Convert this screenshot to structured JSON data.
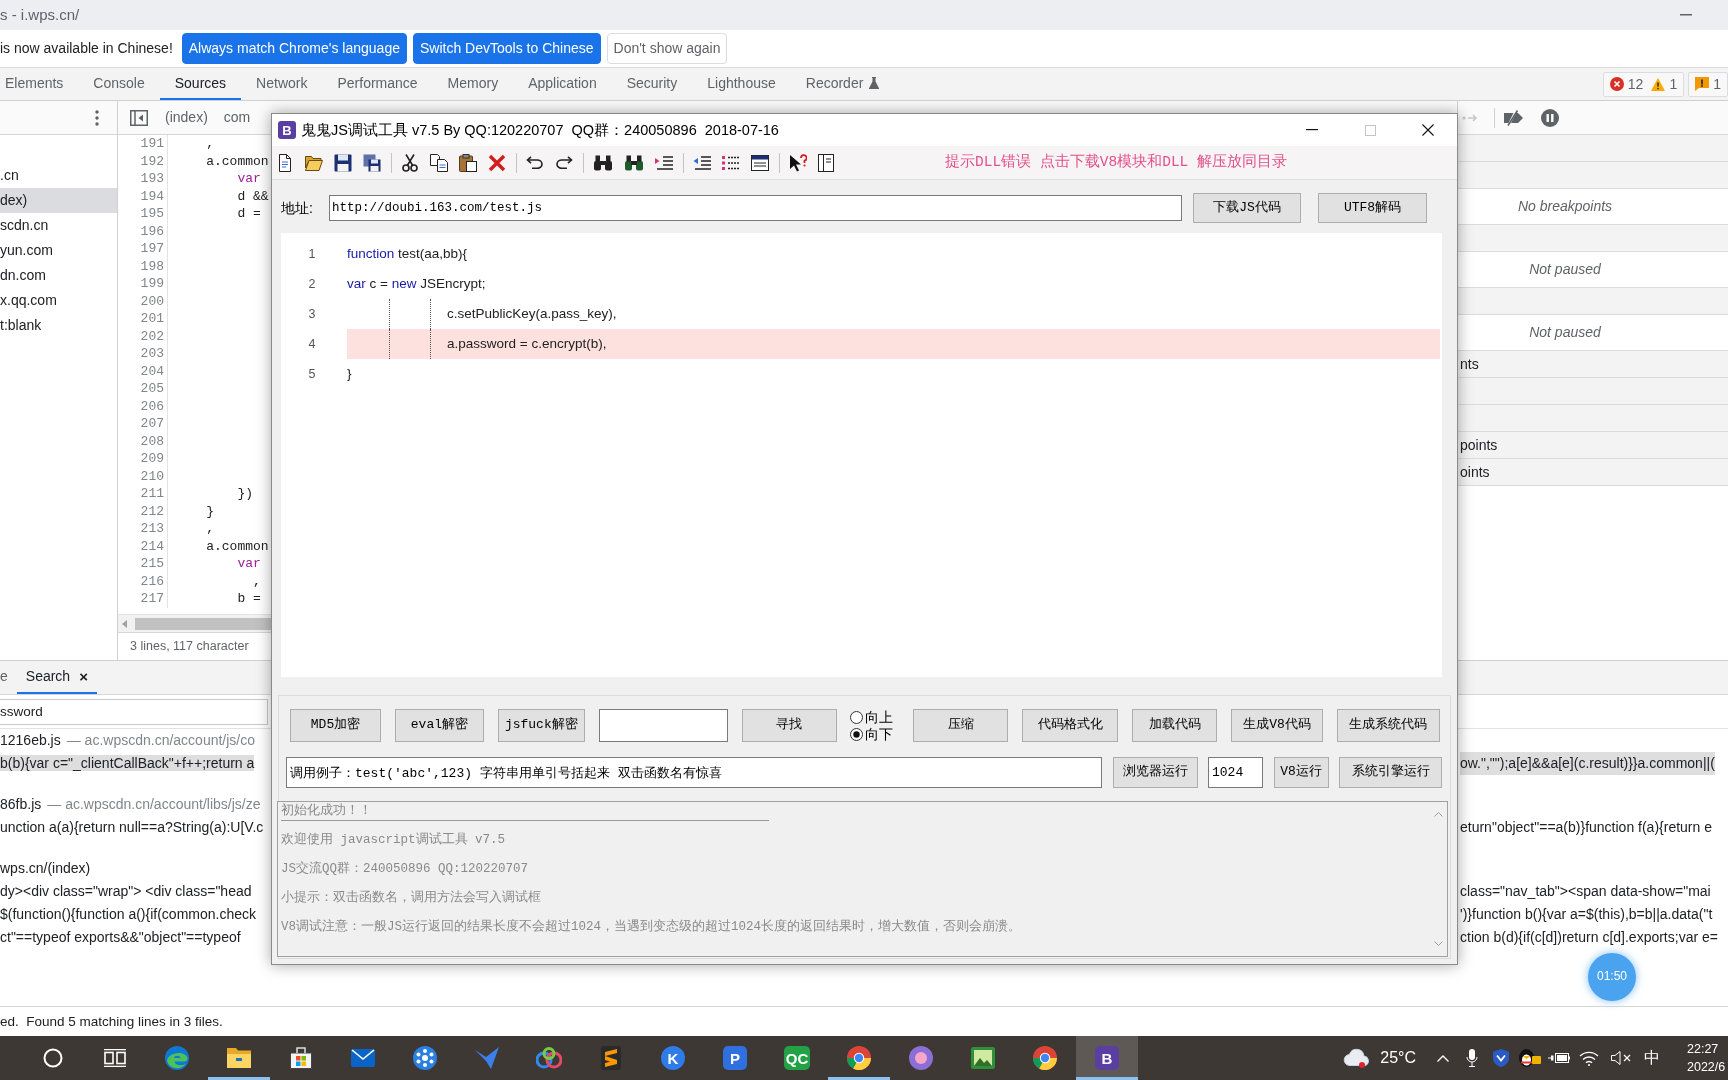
{
  "browser": {
    "title": "s - i.wps.cn/"
  },
  "infobar": {
    "message": "is now available in Chinese!",
    "buttons": [
      {
        "label": "Always match Chrome's language",
        "kind": "primary"
      },
      {
        "label": "Switch DevTools to Chinese",
        "kind": "primary"
      },
      {
        "label": "Don't show again",
        "kind": "secondary"
      }
    ]
  },
  "devtools_tabs": [
    {
      "label": "Elements",
      "selected": false,
      "experimental": false
    },
    {
      "label": "Console",
      "selected": false,
      "experimental": false
    },
    {
      "label": "Sources",
      "selected": true,
      "experimental": false
    },
    {
      "label": "Network",
      "selected": false,
      "experimental": false
    },
    {
      "label": "Performance",
      "selected": false,
      "experimental": false
    },
    {
      "label": "Memory",
      "selected": false,
      "experimental": false
    },
    {
      "label": "Application",
      "selected": false,
      "experimental": false
    },
    {
      "label": "Security",
      "selected": false,
      "experimental": false
    },
    {
      "label": "Lighthouse",
      "selected": false,
      "experimental": false
    },
    {
      "label": "Recorder",
      "selected": false,
      "experimental": true
    }
  ],
  "issue_counters": [
    {
      "items": [
        {
          "kind": "error",
          "count": "12"
        },
        {
          "kind": "warning",
          "count": "1"
        }
      ]
    },
    {
      "items": [
        {
          "kind": "issue",
          "count": "1"
        }
      ]
    }
  ],
  "navigator": {
    "items": [
      {
        "label": ".cn",
        "selected": false
      },
      {
        "label": "dex)",
        "selected": true
      },
      {
        "label": "scdn.cn",
        "selected": false
      },
      {
        "label": "yun.com",
        "selected": false
      },
      {
        "label": "dn.com",
        "selected": false
      },
      {
        "label": "x.qq.com",
        "selected": false
      },
      {
        "label": "t:blank",
        "selected": false
      }
    ]
  },
  "editor": {
    "tabs": [
      {
        "label": "(index)"
      },
      {
        "label": "com"
      }
    ],
    "lines": [
      {
        "number": "191",
        "code": "    ,"
      },
      {
        "number": "192",
        "code": "    a.common"
      },
      {
        "number": "193",
        "code": "        var",
        "kind": "keyword"
      },
      {
        "number": "194",
        "code": "        d &&"
      },
      {
        "number": "195",
        "code": "        d ="
      },
      {
        "number": "196"
      },
      {
        "number": "197"
      },
      {
        "number": "198"
      },
      {
        "number": "199"
      },
      {
        "number": "200"
      },
      {
        "number": "201"
      },
      {
        "number": "202"
      },
      {
        "number": "203"
      },
      {
        "number": "204"
      },
      {
        "number": "205"
      },
      {
        "number": "206"
      },
      {
        "number": "207"
      },
      {
        "number": "208"
      },
      {
        "number": "209"
      },
      {
        "number": "210"
      },
      {
        "number": "211",
        "code": "        })"
      },
      {
        "number": "212",
        "code": "    }"
      },
      {
        "number": "213",
        "code": "    ,"
      },
      {
        "number": "214",
        "code": "    a.common"
      },
      {
        "number": "215",
        "code": "        var",
        "kind": "keyword"
      },
      {
        "number": "216",
        "code": "          ,"
      },
      {
        "number": "217",
        "code": "        b ="
      }
    ],
    "status": "3 lines, 117 character"
  },
  "debugger_pane": {
    "rows": [
      {
        "kind": "header"
      },
      {
        "kind": "header"
      },
      {
        "kind": "message",
        "text": "No breakpoints"
      },
      {
        "kind": "header"
      },
      {
        "kind": "message",
        "text": "Not paused"
      },
      {
        "kind": "header"
      },
      {
        "kind": "message",
        "text": "Not paused"
      },
      {
        "kind": "header",
        "text": "nts"
      },
      {
        "kind": "header"
      },
      {
        "kind": "header"
      },
      {
        "kind": "header",
        "text": "points"
      },
      {
        "kind": "header",
        "text": "oints"
      }
    ]
  },
  "drawer": {
    "tabs": [
      {
        "label": "e",
        "selected": false
      },
      {
        "label": "Search",
        "selected": true,
        "close": "×"
      }
    ],
    "query": "ssword",
    "results": [
      {
        "kind": "file",
        "name": "1216eb.js",
        "path": "— ac.wpscdn.cn/account/js/co",
        "selected": false
      },
      {
        "kind": "match",
        "left": "b(b){var c=\"_clientCallBack\"+f++;return a",
        "right": "ow.\",\"\");a[e]&&a[e](c.result)}}a.common||(",
        "selected": true
      },
      {
        "kind": "file",
        "name": "86fb.js",
        "path": "— ac.wpscdn.cn/account/libs/js/ze",
        "selected": false
      },
      {
        "kind": "match",
        "left": "unction a(a){return null==a?String(a):U[V.c",
        "right": "eturn\"object\"==a(b)}function f(a){return e",
        "selected": false
      },
      {
        "kind": "file",
        "name": "wps.cn/(index)",
        "selected": false
      },
      {
        "kind": "match",
        "left": "dy><div class=\"wrap\"> <div class=\"head",
        "right": "class=\"nav_tab\"><span data-show=\"mai",
        "selected": false
      },
      {
        "kind": "match",
        "left": "$(function(){function a(){if(common.check",
        "right": "')}function b(){var a=$(this),b=b||a.data(\"t",
        "selected": false
      },
      {
        "kind": "match",
        "left": "ct\"==typeof exports&&\"object\"==typeof",
        "right": "ction b(d){if(c[d])return c[d].exports;var e=",
        "selected": false
      }
    ],
    "status": "ed.  Found 5 matching lines in 3 files."
  },
  "tool_window": {
    "logo": "B",
    "title": "鬼鬼JS调试工具 v7.5 By QQ:120220707  QQ群：240050896  2018-07-16",
    "toolbar": [
      {
        "kind": "new"
      },
      {
        "kind": "open"
      },
      {
        "kind": "save"
      },
      {
        "kind": "save-all"
      },
      {
        "kind": "separator"
      },
      {
        "kind": "cut"
      },
      {
        "kind": "copy"
      },
      {
        "kind": "paste"
      },
      {
        "kind": "delete"
      },
      {
        "kind": "separator"
      },
      {
        "kind": "undo"
      },
      {
        "kind": "redo"
      },
      {
        "kind": "separator"
      },
      {
        "kind": "find"
      },
      {
        "kind": "find-next"
      },
      {
        "kind": "indent"
      },
      {
        "kind": "separator"
      },
      {
        "kind": "outdent"
      },
      {
        "kind": "numbered-list"
      },
      {
        "kind": "window"
      },
      {
        "kind": "separator"
      },
      {
        "kind": "help-pointer"
      },
      {
        "kind": "panel"
      }
    ],
    "notice": "提示DLL错误 点击下载V8模块和DLL 解压放同目录",
    "address": {
      "label": "地址:",
      "value": "http://doubi.163.com/test.js",
      "buttons": [
        "下载JS代码",
        "UTF8解码"
      ]
    },
    "code": [
      {
        "number": "1",
        "indented": false,
        "highlighted": false,
        "tokens": [
          {
            "text": "function",
            "kind": "keyword"
          },
          {
            "text": " test(aa,bb){",
            "kind": "plain"
          }
        ]
      },
      {
        "number": "2",
        "indented": false,
        "highlighted": false,
        "tokens": [
          {
            "text": "var",
            "kind": "keyword"
          },
          {
            "text": " c = ",
            "kind": "plain"
          },
          {
            "text": "new",
            "kind": "keyword"
          },
          {
            "text": " JSEncrypt;",
            "kind": "plain"
          }
        ]
      },
      {
        "number": "3",
        "indented": true,
        "highlighted": false,
        "tokens": [
          {
            "text": "c.setPublicKey(a.pass_key),",
            "kind": "plain"
          }
        ]
      },
      {
        "number": "4",
        "indented": true,
        "highlighted": true,
        "tokens": [
          {
            "text": "a.password = c.encrypt(b),",
            "kind": "plain"
          }
        ]
      },
      {
        "number": "5",
        "indented": false,
        "highlighted": false,
        "tokens": [
          {
            "text": "}",
            "kind": "plain"
          }
        ]
      }
    ],
    "actions": [
      {
        "kind": "button",
        "label": "MD5加密"
      },
      {
        "kind": "button",
        "label": "eval解密"
      },
      {
        "kind": "button",
        "label": "jsfuck解密"
      },
      {
        "kind": "input"
      },
      {
        "kind": "button",
        "label": "寻找"
      },
      {
        "kind": "radios",
        "options": [
          {
            "label": "向上",
            "selected": false
          },
          {
            "label": "向下",
            "selected": true
          }
        ]
      },
      {
        "kind": "button",
        "label": "压缩"
      },
      {
        "kind": "button",
        "label": "代码格式化"
      },
      {
        "kind": "button",
        "label": "加载代码"
      },
      {
        "kind": "button",
        "label": "生成V8代码"
      },
      {
        "kind": "button",
        "label": "生成系统代码"
      }
    ],
    "run_row": [
      {
        "kind": "input",
        "value": "调用例子：test('abc',123) 字符串用单引号括起来 双击函数名有惊喜"
      },
      {
        "kind": "button",
        "label": "浏览器运行"
      },
      {
        "kind": "input",
        "value": "1024"
      },
      {
        "kind": "button",
        "label": "V8运行"
      },
      {
        "kind": "button",
        "label": "系统引擎运行"
      }
    ],
    "output": [
      "初始化成功！！",
      "欢迎使用 javascript调试工具 v7.5",
      "JS交流QQ群：240050896  QQ:120220707",
      "小提示：双击函数名，调用方法会写入调试框",
      "V8调试注意：一般JS运行返回的结果长度不会超过1024，当遇到变态级的超过1024长度的返回结果时，增大数值，否则会崩溃。"
    ]
  },
  "recorder_timer": {
    "time": "01:50"
  },
  "taskbar": {
    "apps": [
      {
        "kind": "search",
        "selected": false,
        "running": false
      },
      {
        "kind": "task-view",
        "selected": false,
        "running": false
      },
      {
        "kind": "edge",
        "selected": false,
        "running": false
      },
      {
        "kind": "folder",
        "selected": false,
        "running": true
      },
      {
        "kind": "store",
        "selected": false,
        "running": false
      },
      {
        "kind": "mail",
        "selected": false,
        "running": false
      },
      {
        "kind": "hub",
        "selected": false,
        "running": false
      },
      {
        "kind": "plane",
        "selected": false,
        "running": false
      },
      {
        "kind": "rings",
        "selected": false,
        "running": false
      },
      {
        "kind": "stripes",
        "selected": false,
        "running": false
      },
      {
        "kind": "letter-circle",
        "label": "K",
        "color": "#2f7be8",
        "selected": false,
        "running": false
      },
      {
        "kind": "letter-tile",
        "label": "P",
        "color": "#2f6fe0",
        "selected": false,
        "running": false
      },
      {
        "kind": "letter-tile",
        "label": "QC",
        "color": "#23a245",
        "selected": false,
        "running": false
      },
      {
        "kind": "chrome",
        "selected": false,
        "running": true
      },
      {
        "kind": "orb",
        "selected": false,
        "running": false
      },
      {
        "kind": "picture",
        "selected": false,
        "running": false
      },
      {
        "kind": "chrome",
        "selected": false,
        "running": false
      },
      {
        "kind": "letter-tile",
        "label": "B",
        "color": "#5b3fa0",
        "selected": true,
        "running": true
      }
    ],
    "weather": "25°C",
    "tray": [
      {
        "kind": "chevron"
      },
      {
        "kind": "mic"
      },
      {
        "kind": "shield"
      },
      {
        "kind": "penguin"
      },
      {
        "kind": "battery"
      },
      {
        "kind": "wifi"
      },
      {
        "kind": "speaker-muted"
      }
    ],
    "ime": "中",
    "time": "22:27",
    "date": "2022/6"
  }
}
